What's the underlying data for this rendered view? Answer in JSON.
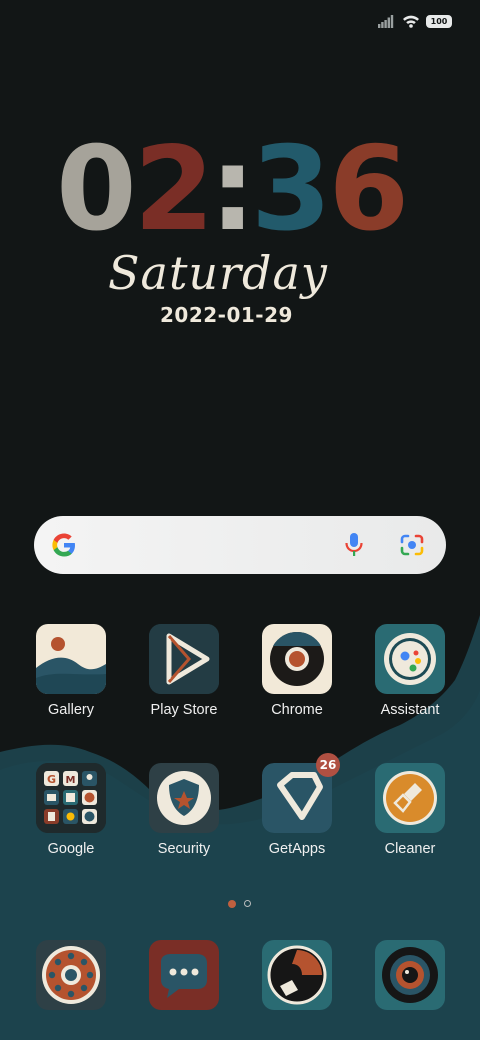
{
  "status_bar": {
    "battery_level": "100",
    "icons": [
      "signal-icon",
      "wifi-icon",
      "battery-icon"
    ]
  },
  "clock": {
    "time_digits": [
      "0",
      "2",
      ":",
      "3",
      "6"
    ],
    "day": "Saturday",
    "date": "2022-01-29"
  },
  "search": {
    "icons": [
      "google-icon",
      "microphone-icon",
      "lens-icon"
    ]
  },
  "apps": [
    {
      "label": "Gallery",
      "icon": "gallery-icon"
    },
    {
      "label": "Play Store",
      "icon": "play-store-icon"
    },
    {
      "label": "Chrome",
      "icon": "chrome-icon"
    },
    {
      "label": "Assistant",
      "icon": "assistant-icon"
    },
    {
      "label": "Google",
      "icon": "google-folder-icon"
    },
    {
      "label": "Security",
      "icon": "security-icon"
    },
    {
      "label": "GetApps",
      "icon": "getapps-icon",
      "badge": "26"
    },
    {
      "label": "Cleaner",
      "icon": "cleaner-icon"
    }
  ],
  "dock": [
    {
      "icon": "phone-dialer-icon"
    },
    {
      "icon": "messages-icon"
    },
    {
      "icon": "browser-icon"
    },
    {
      "icon": "camera-icon"
    }
  ],
  "page_indicator": {
    "pages": 2,
    "current": 1
  },
  "colors": {
    "background": "#121616",
    "wave": "#1c4049",
    "clock_0": "#a6a39a",
    "clock_2": "#7a2e26",
    "clock_colon": "#b8b6ae",
    "clock_3": "#225a6b",
    "clock_6": "#8a3c29",
    "text_light": "#efe9dc"
  }
}
